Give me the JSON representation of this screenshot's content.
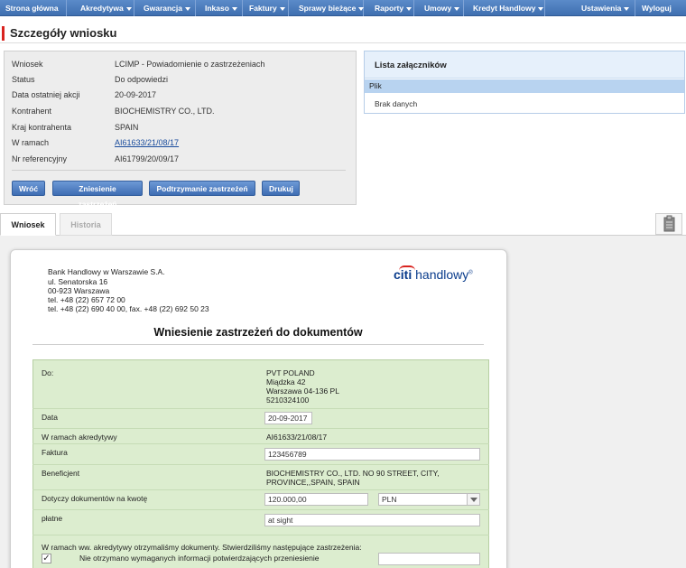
{
  "nav": {
    "items": [
      {
        "label": "Strona główna",
        "caret": false
      },
      {
        "label": "Akredytywa",
        "caret": true
      },
      {
        "label": "Gwarancja",
        "caret": true
      },
      {
        "label": "Inkaso",
        "caret": true
      },
      {
        "label": "Faktury",
        "caret": true
      },
      {
        "label": "Sprawy bieżące",
        "caret": true
      },
      {
        "label": "Raporty",
        "caret": true
      },
      {
        "label": "Umowy",
        "caret": true
      },
      {
        "label": "Kredyt Handlowy",
        "caret": true
      }
    ],
    "settings_label": "Ustawienia",
    "logout_label": "Wyloguj"
  },
  "page": {
    "title": "Szczegóły wniosku"
  },
  "details": {
    "rows": [
      {
        "label": "Wniosek",
        "value": "LCIMP - Powiadomienie o zastrzeżeniach"
      },
      {
        "label": "Status",
        "value": "Do odpowiedzi"
      },
      {
        "label": "Data ostatniej akcji",
        "value": "20-09-2017"
      },
      {
        "label": "Kontrahent",
        "value": "BIOCHEMISTRY CO., LTD."
      },
      {
        "label": "Kraj kontrahenta",
        "value": "SPAIN"
      },
      {
        "label": "W ramach",
        "value": "AI61633/21/08/17"
      },
      {
        "label": "Nr referencyjny",
        "value": "AI61799/20/09/17"
      }
    ],
    "buttons": {
      "back": "Wróć",
      "remove": "Zniesienie zastrzeżeń",
      "maintain": "Podtrzymanie zastrzeżeń",
      "print": "Drukuj"
    }
  },
  "attachments": {
    "title": "Lista załączników",
    "column": "Plik",
    "empty": "Brak danych"
  },
  "tabs": {
    "active": "Wniosek",
    "inactive": "Historia"
  },
  "document": {
    "bank_lines": [
      "Bank Handlowy w Warszawie S.A.",
      "ul. Senatorska 16",
      "00-923 Warszawa",
      "tel. +48 (22) 657 72 00",
      "tel. +48 (22) 690 40 00, fax. +48 (22) 692 50 23"
    ],
    "logo_citi": "citi",
    "logo_handlowy": "handlowy",
    "logo_mark": "®",
    "title": "Wniesienie zastrzeżeń do dokumentów",
    "form": {
      "to_label": "Do:",
      "to_lines": [
        "PVT POLAND",
        "Miądzka 42",
        "Warszawa 04-136 PL",
        "5210324100"
      ],
      "date_label": "Data",
      "date_value": "20-09-2017",
      "credit_label": "W ramach akredytywy",
      "credit_value": "AI61633/21/08/17",
      "invoice_label": "Faktura",
      "invoice_value": "123456789",
      "beneficiary_label": "Beneficjent",
      "beneficiary_lines": [
        "BIOCHEMISTRY CO., LTD. NO 90 STREET, CITY,",
        "PROVINCE,,SPAIN, SPAIN"
      ],
      "amount_label": "Dotyczy dokumentów na kwotę",
      "amount_value": "120.000,00",
      "currency_value": "PLN",
      "payable_label": "płatne",
      "payable_value": "at sight",
      "notice_text": "W ramach ww. akredytywy otrzymaliśmy dokumenty. Stwierdziliśmy następujące zastrzeżenia:",
      "checkbox_label": "Nie otrzymano wymaganych informacji potwierdzających przeniesienie",
      "checkbox_mark": "✓"
    }
  }
}
